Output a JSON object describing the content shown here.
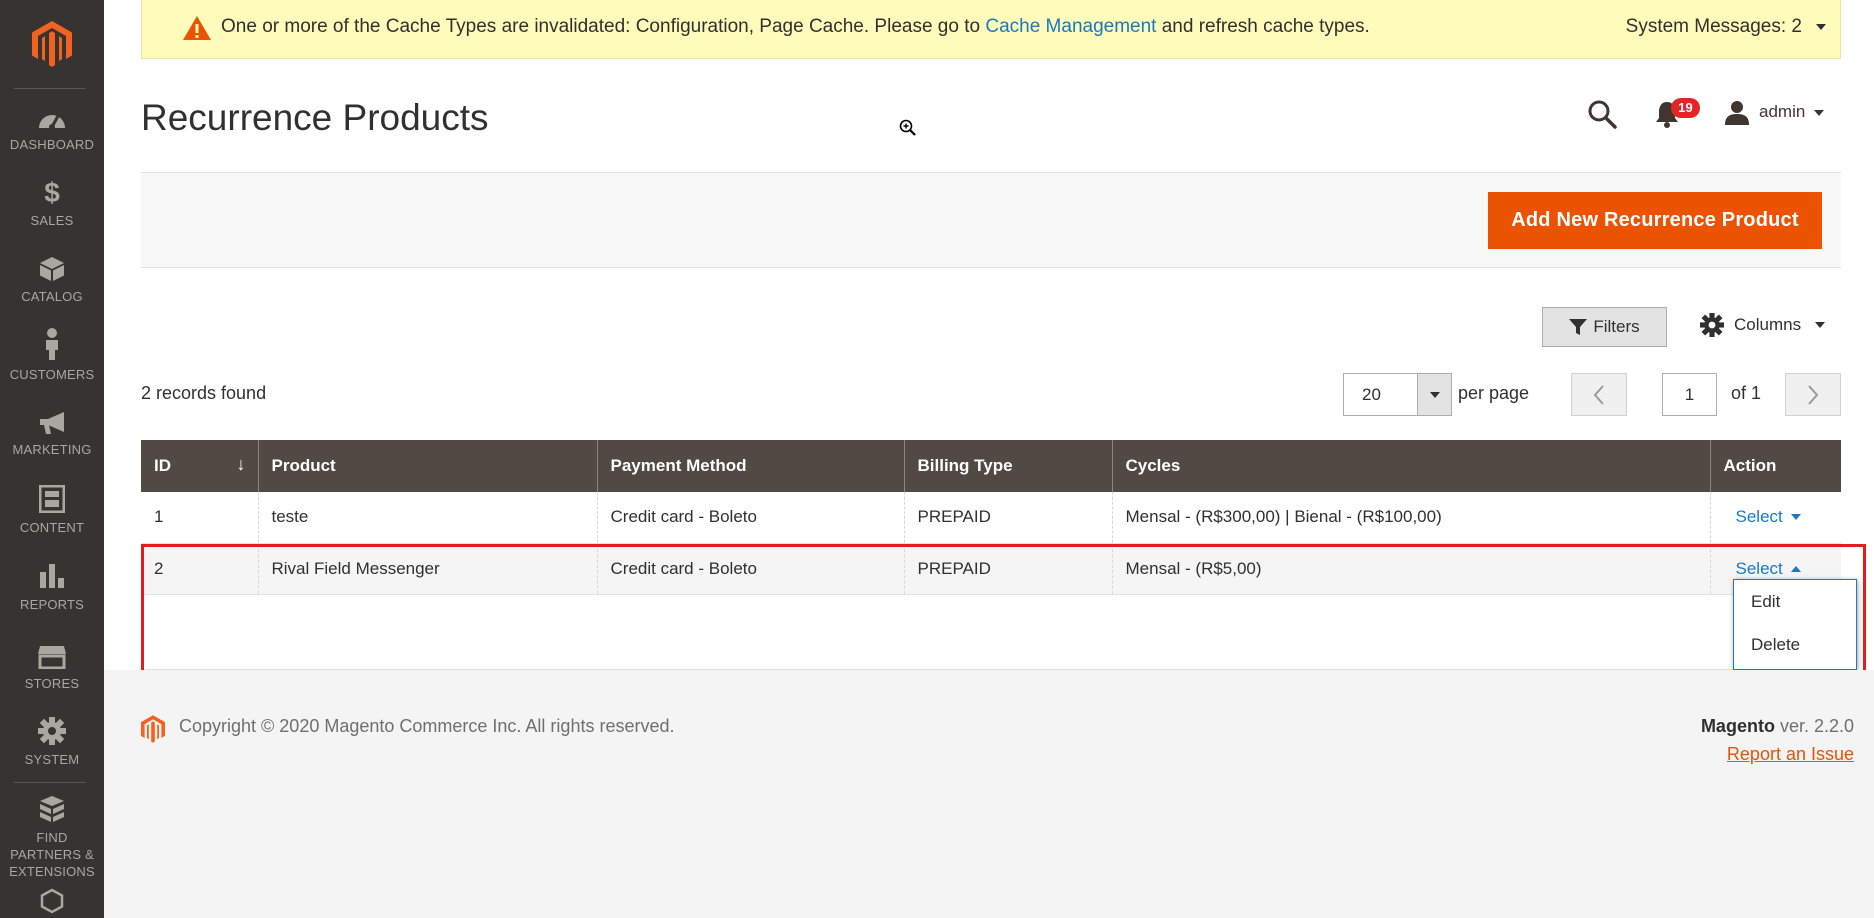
{
  "colors": {
    "sidebar_bg": "#373330",
    "accent_orange": "#eb5202",
    "link_blue": "#1979c3",
    "table_header_bg": "#514943",
    "message_bg": "#fffbbb",
    "highlight_red": "#e01e1e"
  },
  "sidebar": {
    "items": [
      {
        "label": "Dashboard",
        "icon": "dashboard-icon"
      },
      {
        "label": "Sales",
        "icon": "dollar-icon"
      },
      {
        "label": "Catalog",
        "icon": "cube-icon"
      },
      {
        "label": "Customers",
        "icon": "person-icon"
      },
      {
        "label": "Marketing",
        "icon": "megaphone-icon"
      },
      {
        "label": "Content",
        "icon": "layout-icon"
      },
      {
        "label": "Reports",
        "icon": "bar-chart-icon"
      },
      {
        "label": "Stores",
        "icon": "store-icon"
      },
      {
        "label": "System",
        "icon": "gear-icon"
      },
      {
        "label": "Find Partners & Extensions",
        "icon": "boxes-icon"
      }
    ]
  },
  "system_message": {
    "text_before": "One or more of the Cache Types are invalidated: Configuration, Page Cache. Please go to ",
    "link": "Cache Management",
    "text_after": " and refresh cache types.",
    "count_label": "System Messages: 2"
  },
  "header": {
    "page_title": "Recurrence Products",
    "notification_count": "19",
    "username": "admin"
  },
  "actions": {
    "add_button": "Add New Recurrence Product"
  },
  "grid": {
    "filters_label": "Filters",
    "columns_label": "Columns",
    "records_found": "2 records found",
    "per_page_value": "20",
    "per_page_label": "per page",
    "current_page": "1",
    "of_pages": "of 1",
    "columns": [
      "ID",
      "Product",
      "Payment Method",
      "Billing Type",
      "Cycles",
      "Action"
    ],
    "rows": [
      {
        "id": "1",
        "product": "teste",
        "payment": "Credit card - Boleto",
        "billing": "PREPAID",
        "cycles": "Mensal - (R$300,00) | Bienal - (R$100,00)",
        "action": "Select"
      },
      {
        "id": "2",
        "product": "Rival Field Messenger",
        "payment": "Credit card - Boleto",
        "billing": "PREPAID",
        "cycles": "Mensal - (R$5,00)",
        "action": "Select"
      }
    ],
    "action_menu": [
      "Edit",
      "Delete"
    ]
  },
  "footer": {
    "copyright": "Copyright © 2020 Magento Commerce Inc. All rights reserved.",
    "brand": "Magento",
    "version": " ver. 2.2.0",
    "report_link": "Report an Issue"
  }
}
